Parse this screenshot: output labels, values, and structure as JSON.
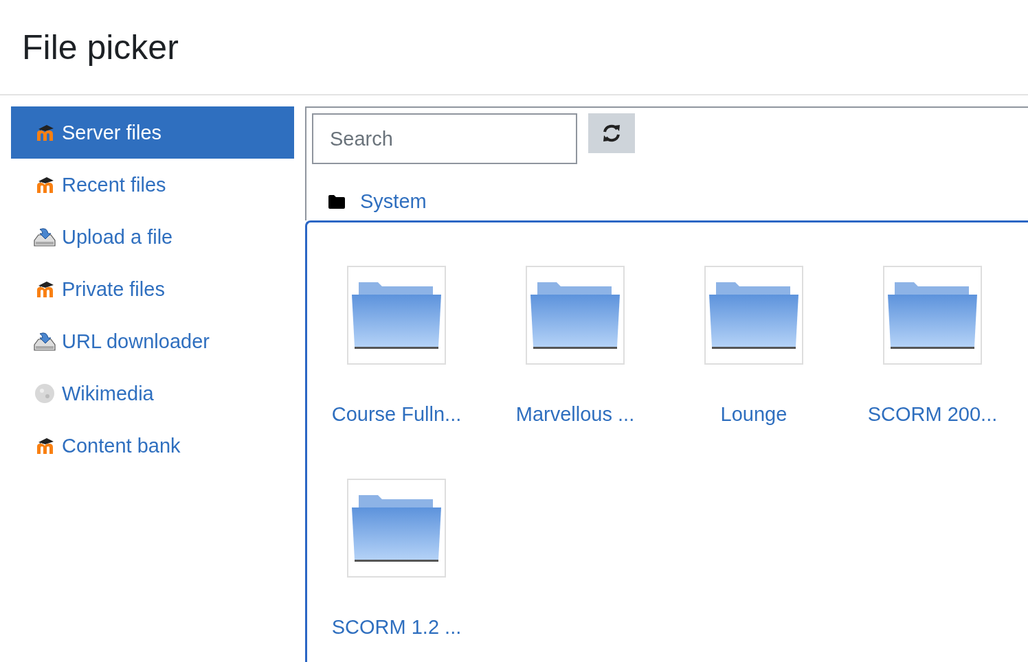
{
  "title": "File picker",
  "sidebar": {
    "items": [
      {
        "label": "Server files",
        "kind": "moodle",
        "selected": true
      },
      {
        "label": "Recent files",
        "kind": "moodle",
        "selected": false
      },
      {
        "label": "Upload a file",
        "kind": "upload",
        "selected": false
      },
      {
        "label": "Private files",
        "kind": "moodle",
        "selected": false
      },
      {
        "label": "URL downloader",
        "kind": "upload",
        "selected": false
      },
      {
        "label": "Wikimedia",
        "kind": "wiki",
        "selected": false
      },
      {
        "label": "Content bank",
        "kind": "moodle",
        "selected": false
      }
    ]
  },
  "search": {
    "placeholder": "Search"
  },
  "breadcrumb": {
    "label": "System"
  },
  "folders": [
    {
      "name": "Course Fulln..."
    },
    {
      "name": "Marvellous ..."
    },
    {
      "name": "Lounge"
    },
    {
      "name": "SCORM 200..."
    },
    {
      "name": "SCORM 1.2 ..."
    }
  ]
}
